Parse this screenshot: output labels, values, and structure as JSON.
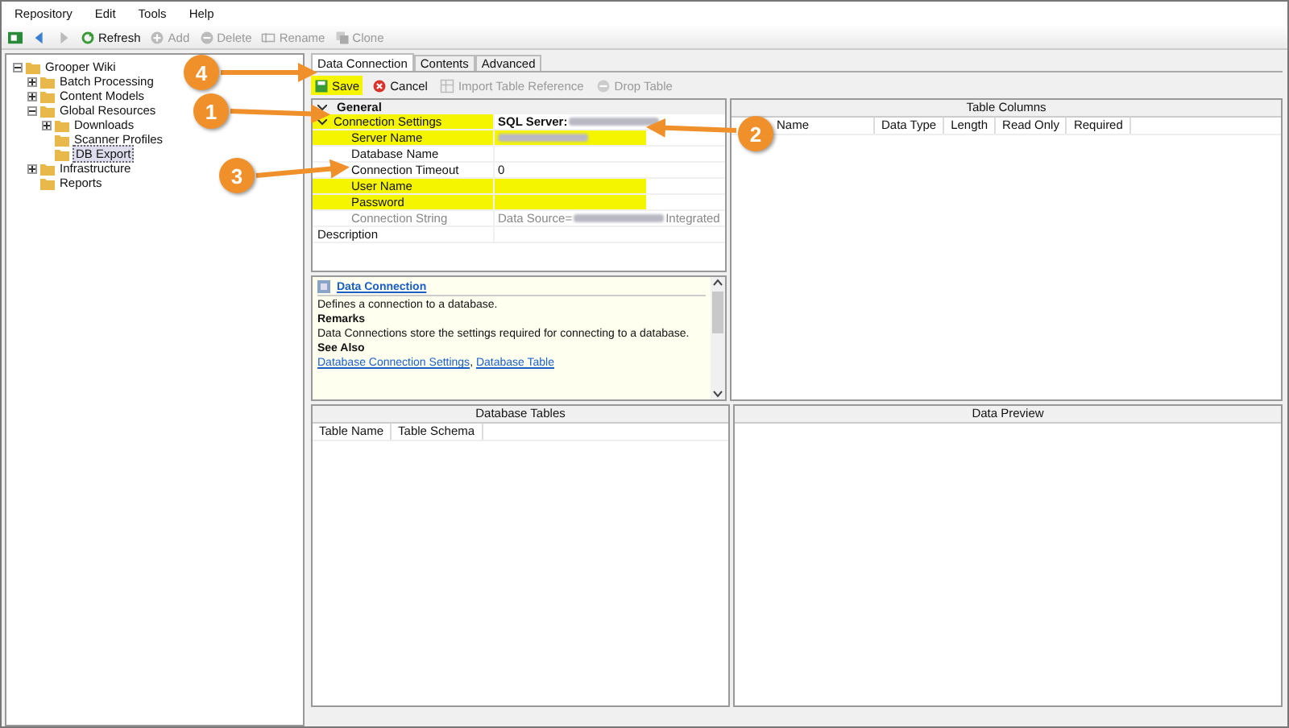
{
  "menu": [
    "Repository",
    "Edit",
    "Tools",
    "Help"
  ],
  "toolbar": [
    {
      "kind": "refresh",
      "label": "Refresh",
      "disabled": false
    },
    {
      "kind": "add",
      "label": "Add",
      "disabled": true
    },
    {
      "kind": "delete",
      "label": "Delete",
      "disabled": true
    },
    {
      "kind": "rename",
      "label": "Rename",
      "disabled": true
    },
    {
      "kind": "clone",
      "label": "Clone",
      "disabled": true
    }
  ],
  "tree": [
    {
      "label": "Grooper Wiki",
      "expandable": true,
      "expanded": true,
      "selected": false,
      "children": [
        {
          "label": "Batch Processing",
          "expandable": true,
          "expanded": false,
          "selected": false
        },
        {
          "label": "Content Models",
          "expandable": true,
          "expanded": false,
          "selected": false
        },
        {
          "label": "Global Resources",
          "expandable": true,
          "expanded": true,
          "selected": false,
          "children": [
            {
              "label": "Downloads",
              "expandable": true,
              "expanded": false,
              "selected": false
            },
            {
              "label": "Scanner Profiles",
              "expandable": false,
              "selected": false
            },
            {
              "label": "DB Export",
              "expandable": false,
              "selected": true
            }
          ]
        },
        {
          "label": "Infrastructure",
          "expandable": true,
          "expanded": false,
          "selected": false
        },
        {
          "label": "Reports",
          "expandable": false,
          "selected": false
        }
      ]
    }
  ],
  "tabs": [
    {
      "label": "Data Connection",
      "selected": true
    },
    {
      "label": "Contents",
      "selected": false
    },
    {
      "label": "Advanced",
      "selected": false
    }
  ],
  "editor_toolbar": [
    {
      "kind": "save",
      "label": "Save",
      "disabled": false,
      "highlighted": true
    },
    {
      "kind": "cancel",
      "label": "Cancel",
      "disabled": false,
      "highlighted": false
    },
    {
      "kind": "import",
      "label": "Import Table Reference",
      "disabled": true,
      "highlighted": false
    },
    {
      "kind": "drop",
      "label": "Drop Table",
      "disabled": true,
      "highlighted": false
    }
  ],
  "property_grid": {
    "category": "General",
    "rows": [
      {
        "label": "Connection Settings",
        "kind": "group",
        "label_highlighted": true,
        "value_highlighted": false,
        "disabled": false,
        "value": [
          {
            "kind": "text",
            "text": "SQL Server:"
          },
          {
            "kind": "redacted"
          }
        ]
      },
      {
        "label": "Server Name",
        "kind": "field",
        "label_highlighted": true,
        "value_highlighted": true,
        "disabled": false,
        "value": [
          {
            "kind": "redacted"
          }
        ]
      },
      {
        "label": "Database Name",
        "kind": "field",
        "label_highlighted": false,
        "value_highlighted": false,
        "disabled": false,
        "value": []
      },
      {
        "label": "Connection Timeout",
        "kind": "field",
        "label_highlighted": false,
        "value_highlighted": false,
        "disabled": false,
        "value": [
          {
            "kind": "text",
            "text": "0"
          }
        ]
      },
      {
        "label": "User Name",
        "kind": "field",
        "label_highlighted": true,
        "value_highlighted": true,
        "disabled": false,
        "value": []
      },
      {
        "label": "Password",
        "kind": "field",
        "label_highlighted": true,
        "value_highlighted": true,
        "disabled": false,
        "value": []
      },
      {
        "label": "Connection String",
        "kind": "field",
        "label_highlighted": false,
        "value_highlighted": false,
        "disabled": true,
        "value": [
          {
            "kind": "text",
            "text": "Data Source="
          },
          {
            "kind": "redacted"
          },
          {
            "kind": "text",
            "text": "Integrated"
          }
        ]
      },
      {
        "label": "Description",
        "kind": "top",
        "label_highlighted": false,
        "value_highlighted": false,
        "disabled": false,
        "value": []
      }
    ]
  },
  "help": {
    "title": "Data Connection",
    "blocks": [
      {
        "kind": "text",
        "text": "Defines a connection to a database."
      },
      {
        "kind": "heading",
        "text": "Remarks"
      },
      {
        "kind": "text",
        "text": "Data Connections store the settings required for connecting to a database."
      },
      {
        "kind": "heading",
        "text": "See Also"
      },
      {
        "kind": "links",
        "links": [
          "Database Connection Settings",
          "Database Table"
        ],
        "separator": ","
      }
    ]
  },
  "table_columns": {
    "title": "Table Columns",
    "columns": [
      "Name",
      "Data Type",
      "Length",
      "Read Only",
      "Required"
    ]
  },
  "database_tables": {
    "title": "Database Tables",
    "columns": [
      "Table Name",
      "Table Schema"
    ]
  },
  "data_preview": {
    "title": "Data Preview"
  },
  "callouts": [
    {
      "number": "4"
    },
    {
      "number": "1"
    },
    {
      "number": "3"
    },
    {
      "number": "2"
    }
  ]
}
